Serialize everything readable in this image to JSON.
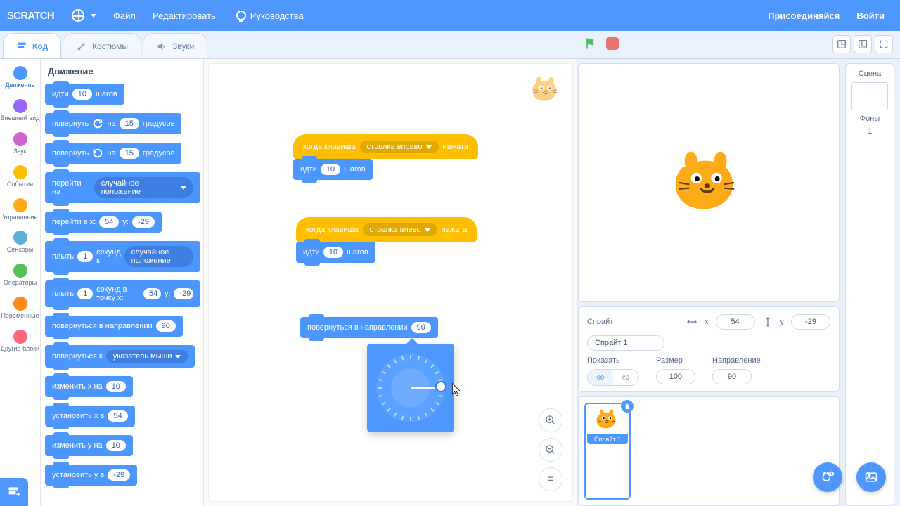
{
  "menu": {
    "file": "Файл",
    "edit": "Редактировать",
    "tutorials": "Руководства",
    "join": "Присоединяйся",
    "signin": "Войти"
  },
  "tabs": {
    "code": "Код",
    "costumes": "Костюмы",
    "sounds": "Звуки"
  },
  "categories": [
    {
      "label": "Движение",
      "color": "#4c97ff",
      "active": true
    },
    {
      "label": "Внешний вид",
      "color": "#9966ff"
    },
    {
      "label": "Звук",
      "color": "#cf63cf"
    },
    {
      "label": "События",
      "color": "#ffbf00"
    },
    {
      "label": "Управление",
      "color": "#ffab19"
    },
    {
      "label": "Сенсоры",
      "color": "#5cb1d6"
    },
    {
      "label": "Операторы",
      "color": "#59c059"
    },
    {
      "label": "Переменные",
      "color": "#ff8c1a"
    },
    {
      "label": "Другие блоки",
      "color": "#ff6680"
    }
  ],
  "palette": {
    "heading": "Движение",
    "move": {
      "pre": "идти",
      "val": "10",
      "post": "шагов"
    },
    "turn_cw": {
      "pre": "повернуть",
      "val": "15",
      "post": "градусов"
    },
    "turn_ccw": {
      "pre": "повернуть",
      "val": "15",
      "post": "градусов"
    },
    "goto": {
      "pre": "перейти на",
      "opt": "случайное положение"
    },
    "gotoxy": {
      "pre": "перейти в x:",
      "x": "54",
      "mid": "y:",
      "y": "-29"
    },
    "glide": {
      "pre": "плыть",
      "sec": "1",
      "mid": "секунд к",
      "opt": "случайное положение"
    },
    "glidexy": {
      "pre": "плыть",
      "sec": "1",
      "mid": "секунд в точку x:",
      "x": "54",
      "mid2": "y:",
      "y": "-29"
    },
    "point_dir": {
      "pre": "повернуться в направлении",
      "val": "90"
    },
    "point_to": {
      "pre": "повернуться к",
      "opt": "указатель мыши"
    },
    "changex": {
      "pre": "изменить x на",
      "val": "10"
    },
    "setx": {
      "pre": "установить x в",
      "val": "54"
    },
    "changey": {
      "pre": "изменить y на",
      "val": "10"
    },
    "sety": {
      "pre": "установить y в",
      "val": "-29"
    }
  },
  "scripts": {
    "hat1": {
      "pre": "когда клавиша",
      "opt": "стрелка вправо",
      "post": "нажата"
    },
    "hat2": {
      "pre": "когда клавиша",
      "opt": "стрелка влево",
      "post": "нажата"
    },
    "move1": {
      "pre": "идти",
      "val": "10",
      "post": "шагов"
    },
    "move2": {
      "pre": "идти",
      "val": "10",
      "post": "шагов"
    },
    "dirblk": {
      "pre": "повернуться в направлении",
      "val": "90"
    }
  },
  "sprite_info": {
    "title": "Спрайт",
    "name": "Спрайт 1",
    "x_label": "x",
    "x": "54",
    "y_label": "y",
    "y": "-29",
    "show": "Показать",
    "size_label": "Размер",
    "size": "100",
    "dir_label": "Направление",
    "dir": "90"
  },
  "scene": {
    "title": "Сцена",
    "backdrops": "Фоны",
    "count": "1"
  },
  "sprite_tile": {
    "name": "Спрайт 1"
  },
  "colors": {
    "motion": "#4c97ff",
    "events": "#ffbf00",
    "accent": "#4d97ff"
  }
}
